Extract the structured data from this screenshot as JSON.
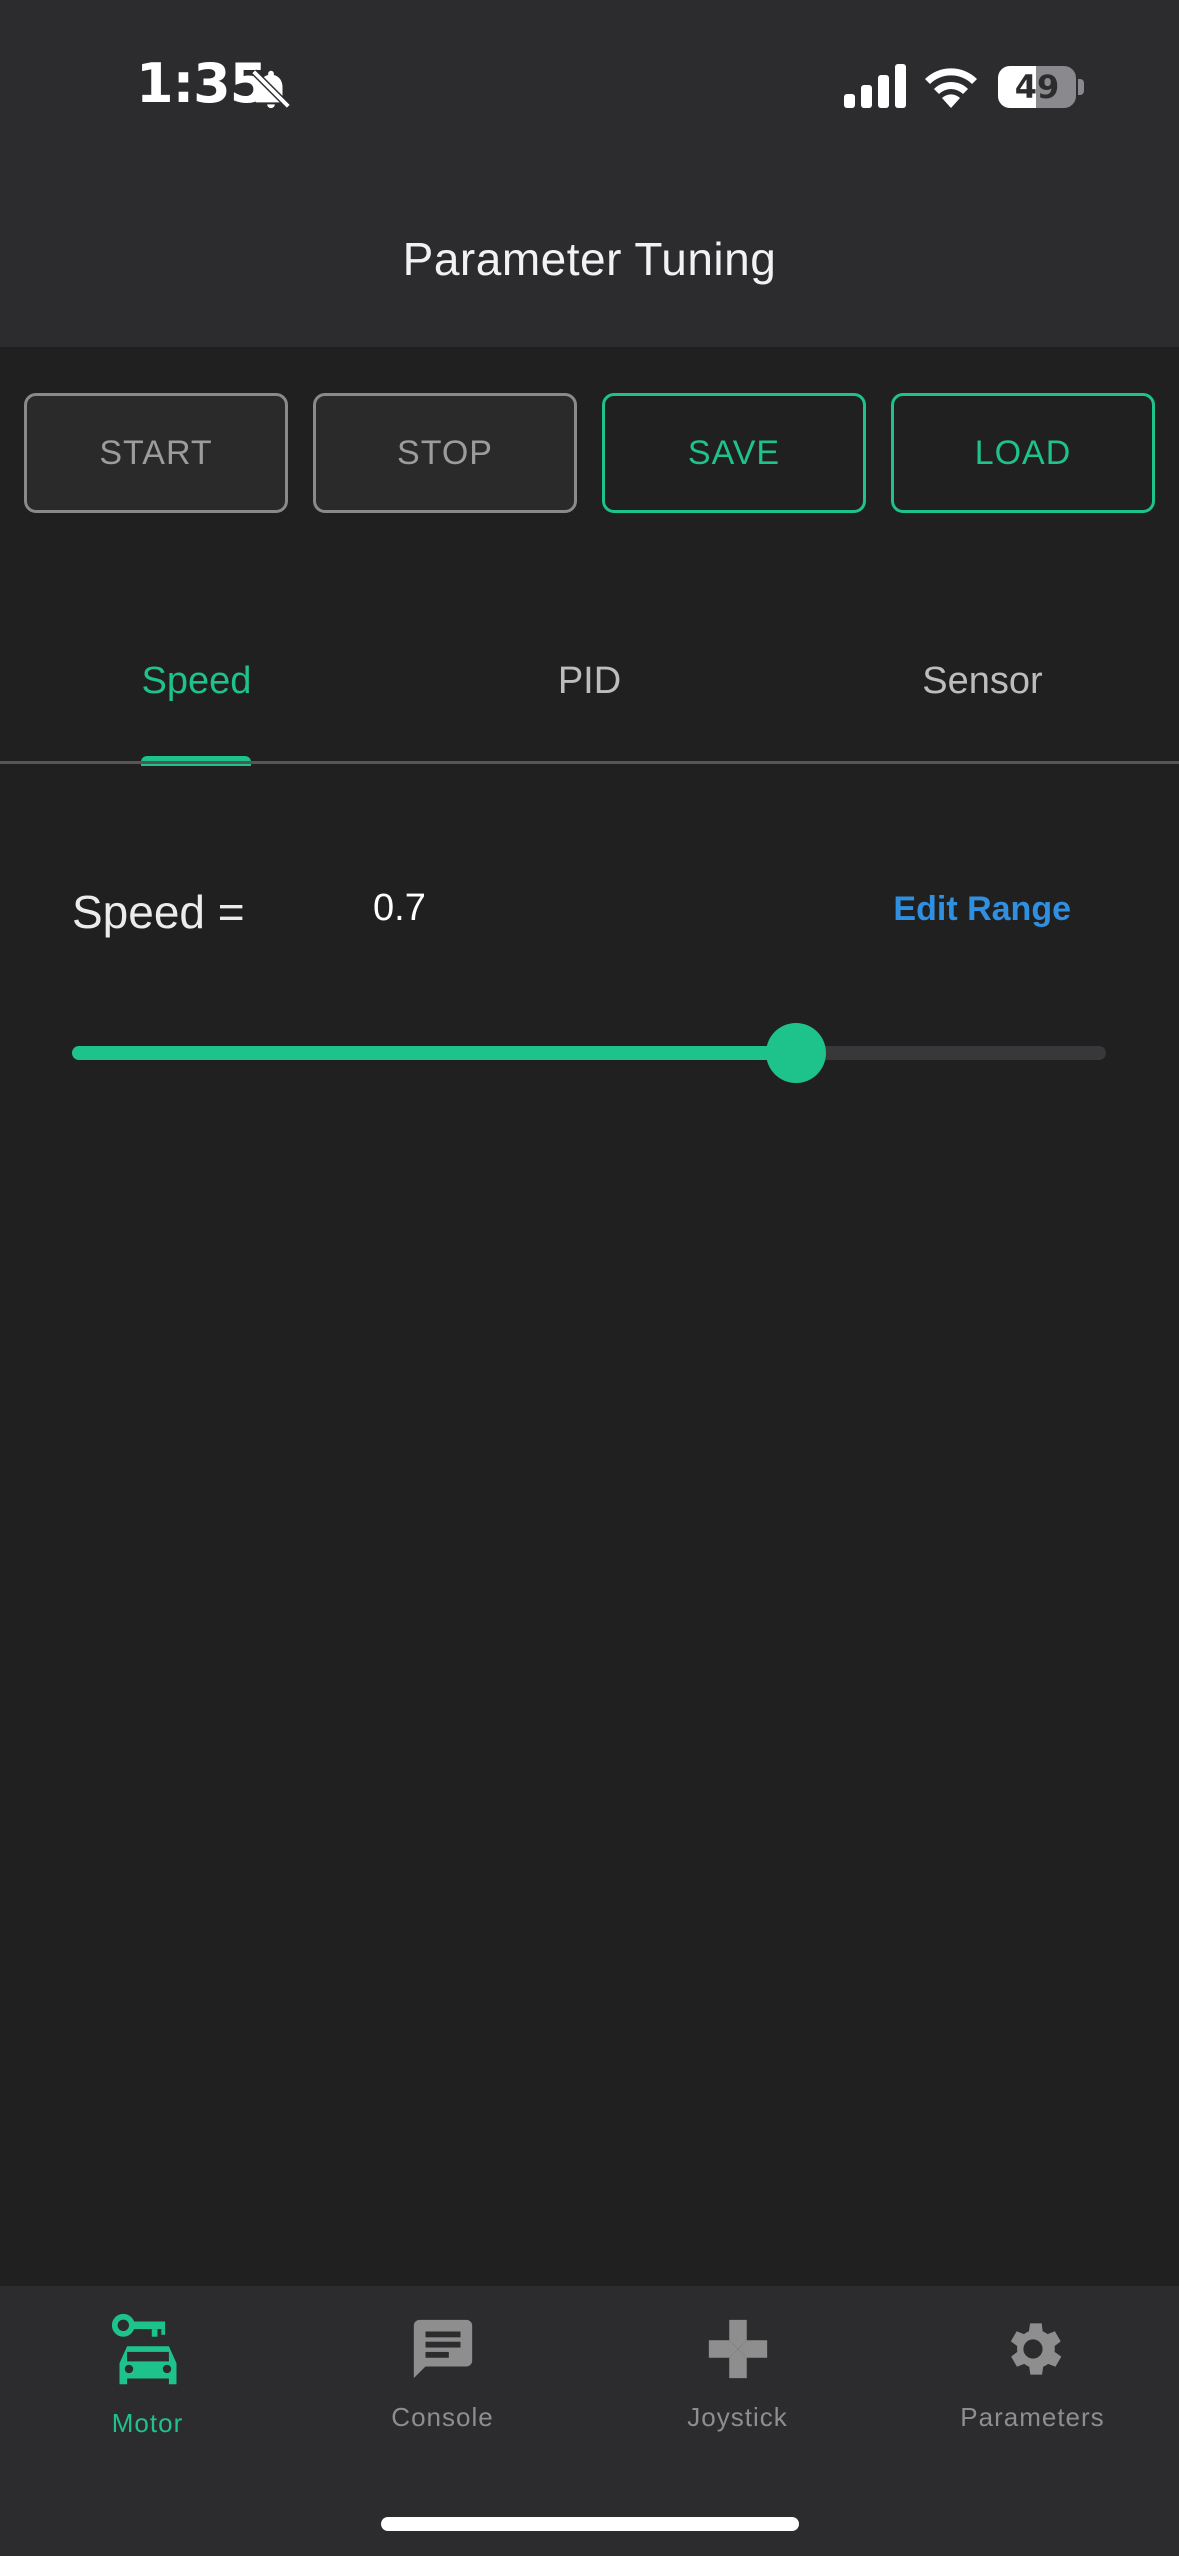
{
  "status_bar": {
    "time": "1:35",
    "battery": "49",
    "battery_level": 0.49,
    "icons": [
      "bell-slash-icon",
      "cellular-signal-icon",
      "wifi-icon",
      "battery-icon"
    ]
  },
  "header": {
    "title": "Parameter Tuning"
  },
  "actions": {
    "start": "START",
    "stop": "STOP",
    "save": "SAVE",
    "load": "LOAD"
  },
  "tabs": [
    {
      "label": "Speed",
      "active": true
    },
    {
      "label": "PID",
      "active": false
    },
    {
      "label": "Sensor",
      "active": false
    }
  ],
  "parameter": {
    "label": "Speed =",
    "value": "0.7",
    "edit_range": "Edit Range",
    "slider_fraction": 0.7
  },
  "bottom_nav": [
    {
      "label": "Motor",
      "icon": "car-key-icon",
      "active": true
    },
    {
      "label": "Console",
      "icon": "message-icon",
      "active": false
    },
    {
      "label": "Joystick",
      "icon": "gamepad-icon",
      "active": false
    },
    {
      "label": "Parameters",
      "icon": "gear-icon",
      "active": false
    }
  ],
  "colors": {
    "accent": "#1ec28b",
    "link": "#2f8fe0",
    "background": "#202020",
    "surface": "#2c2c2e"
  }
}
